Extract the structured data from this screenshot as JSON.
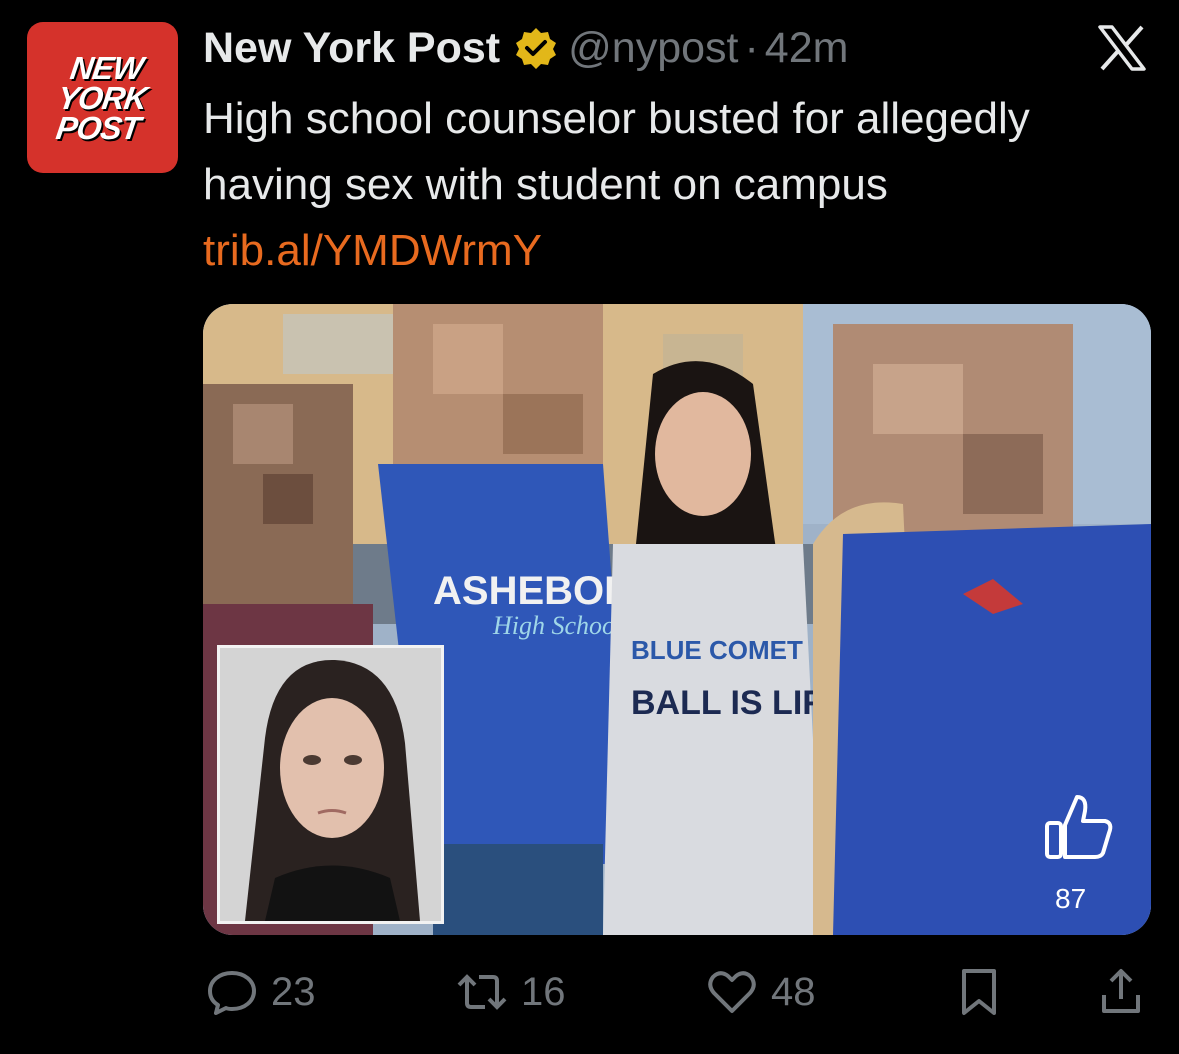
{
  "account": {
    "logo_text": "NEW YORK POST",
    "name": "New York Post",
    "handle": "@nypost",
    "separator": "·",
    "time": "42m"
  },
  "tweet": {
    "text": "High school counselor busted for allegedly having sex with student on campus ",
    "link": "trib.al/YMDWrmY"
  },
  "media": {
    "shirt_text_1": "ASHEBORO",
    "shirt_text_2": "High School",
    "shirt_text_3": "BLUE COMET",
    "shirt_text_4": "BALL IS LIFE",
    "like_count": "87"
  },
  "actions": {
    "replies": "23",
    "reposts": "16",
    "likes": "48"
  },
  "colors": {
    "background": "#000000",
    "logo_red": "#d5322b",
    "verified_gold": "#e2b719",
    "link_orange": "#e86a1f",
    "muted_gray": "#71767b"
  }
}
